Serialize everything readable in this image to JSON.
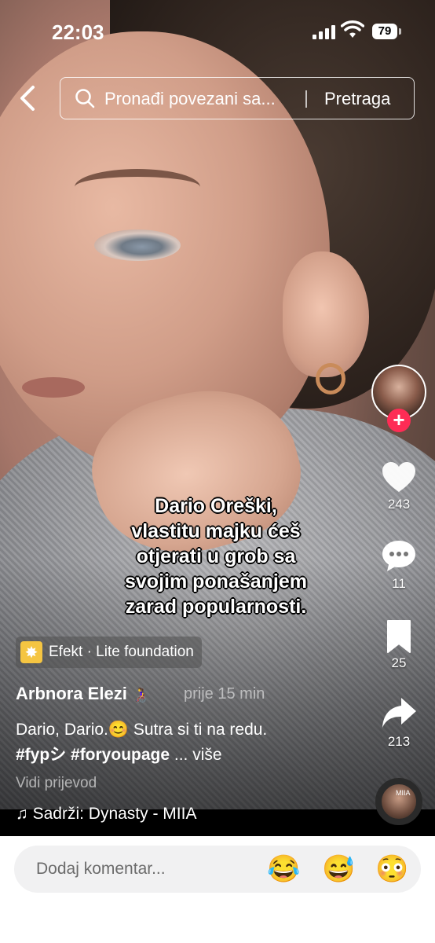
{
  "status_bar": {
    "time": "22:03",
    "battery": "79"
  },
  "search": {
    "placeholder": "Pronađi povezani sa...",
    "button": "Pretraga"
  },
  "overlay_text": [
    "Dario Oreški,",
    "vlastitu majku ćeš",
    "otjerati u grob sa",
    "svojim ponašanjem",
    "zarad popularnosti."
  ],
  "rail": {
    "likes": "243",
    "comments": "11",
    "saves": "25",
    "shares": "213",
    "disc_tag": "MIIA"
  },
  "effect": {
    "label": "Efekt · Lite foundation"
  },
  "post": {
    "username": "Arbnora Elezi",
    "time_ago": "prije 15 min",
    "caption": "Dario, Dario.😊 Sutra si ti na redu.",
    "hashtags": "#fypシ #foryoupage",
    "more": " ... više",
    "translate": "Vidi prijevod",
    "sound": "♫ Sadrži: Dynasty - MIIA"
  },
  "comment": {
    "placeholder": "Dodaj komentar...",
    "emojis": [
      "😂",
      "😅",
      "😳"
    ]
  },
  "icons": [
    "back-icon",
    "search-icon",
    "heart-icon",
    "comment-icon",
    "bookmark-icon",
    "share-icon",
    "plus-icon",
    "effect-icon"
  ]
}
